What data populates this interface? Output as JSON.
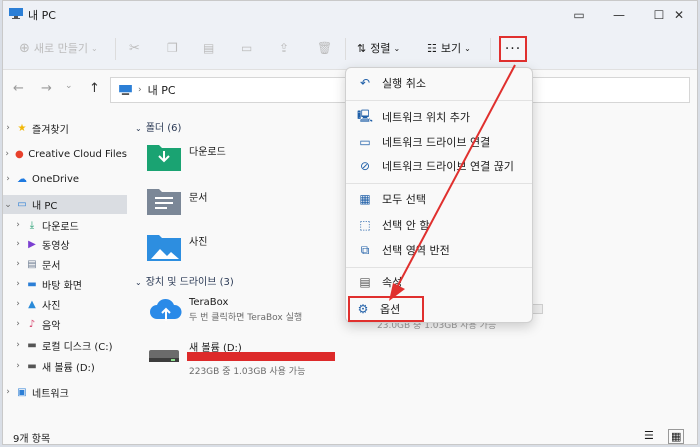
{
  "window": {
    "title": "내 PC",
    "controls": [
      "restore-icon",
      "minimize-icon",
      "maximize-icon",
      "close-icon"
    ]
  },
  "toolbar": {
    "new_label": "새로 만들기",
    "sort_label": "정렬",
    "view_label": "보기",
    "more_label": "···"
  },
  "address": {
    "path": "내 PC"
  },
  "sidebar": {
    "items": [
      {
        "label": "즐겨찾기",
        "icon": "star-icon"
      },
      {
        "label": "Creative Cloud Files",
        "icon": "creative-cloud-icon"
      },
      {
        "label": "OneDrive",
        "icon": "cloud-icon"
      },
      {
        "label": "내 PC",
        "icon": "pc-icon"
      },
      {
        "label": "다운로드",
        "icon": "download-icon"
      },
      {
        "label": "동영상",
        "icon": "video-icon"
      },
      {
        "label": "문서",
        "icon": "document-icon"
      },
      {
        "label": "바탕 화면",
        "icon": "desktop-icon"
      },
      {
        "label": "사진",
        "icon": "picture-icon"
      },
      {
        "label": "음악",
        "icon": "music-icon"
      },
      {
        "label": "로컬 디스크 (C:)",
        "icon": "drive-icon"
      },
      {
        "label": "새 볼륨 (D:)",
        "icon": "drive-icon"
      },
      {
        "label": "네트워크",
        "icon": "network-icon"
      }
    ]
  },
  "content": {
    "folders_header": "폴더 (6)",
    "folders": [
      {
        "label": "다운로드",
        "icon": "download-folder-icon"
      },
      {
        "label": "문서",
        "icon": "document-folder-icon"
      },
      {
        "label": "사진",
        "icon": "picture-folder-icon"
      }
    ],
    "drives_header": "장치 및 드라이브 (3)",
    "drives": [
      {
        "label": "TeraBox",
        "sub": "두 번 클릭하면 TeraBox 실행",
        "extra": "23.0GB 중 1.03GB 사용 가능",
        "icon": "terabox-icon"
      },
      {
        "label": "새 볼륨 (D:)",
        "sub": "223GB 중 1.03GB 사용 가능",
        "icon": "drive-icon"
      }
    ]
  },
  "menu": {
    "items": [
      {
        "label": "실행 취소",
        "icon": "undo-icon"
      },
      {
        "label": "네트워크 위치 추가",
        "icon": "network-location-icon"
      },
      {
        "label": "네트워크 드라이브 연결",
        "icon": "map-drive-icon"
      },
      {
        "label": "네트워크 드라이브 연결 끊기",
        "icon": "disconnect-drive-icon"
      },
      {
        "label": "모두 선택",
        "icon": "select-all-icon"
      },
      {
        "label": "선택 안 함",
        "icon": "select-none-icon"
      },
      {
        "label": "선택 영역 반전",
        "icon": "invert-selection-icon"
      },
      {
        "label": "속성",
        "icon": "properties-icon"
      },
      {
        "label": "옵션",
        "icon": "options-icon"
      }
    ]
  },
  "status": {
    "count": "9개 항목"
  },
  "colors": {
    "accent": "#e0302e",
    "selection": "#dadde2",
    "drive_bar": "#dd2a2a"
  }
}
